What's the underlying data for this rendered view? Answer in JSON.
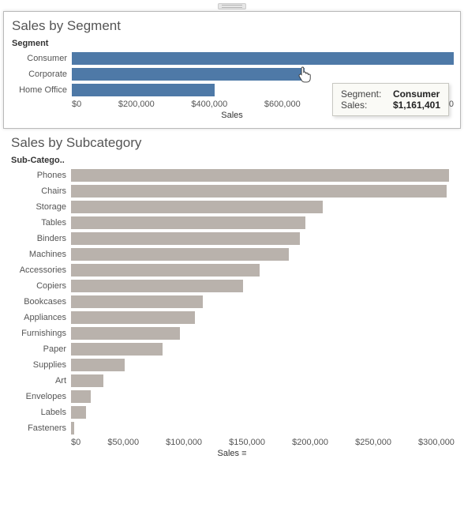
{
  "chart_data": [
    {
      "type": "bar",
      "orientation": "horizontal",
      "title": "Sales by Segment",
      "column_header": "Segment",
      "xlabel": "Sales",
      "xlim": [
        0,
        1150000
      ],
      "ticks": [
        "$0",
        "$200,000",
        "$400,000",
        "$600,000",
        "$800,000",
        "$1,000,000"
      ],
      "categories": [
        "Consumer",
        "Corporate",
        "Home Office"
      ],
      "values": [
        1161401,
        700000,
        430000
      ],
      "bar_color": "#4e79a7",
      "highlighted_index": 0,
      "tooltip": {
        "segment_key": "Segment:",
        "segment_val": "Consumer",
        "sales_key": "Sales:",
        "sales_val": "$1,161,401"
      }
    },
    {
      "type": "bar",
      "orientation": "horizontal",
      "title": "Sales by Subcategory",
      "column_header": "Sub-Catego..",
      "xlabel": "Sales",
      "sort_icon": true,
      "xlim": [
        0,
        335000
      ],
      "ticks": [
        "$0",
        "$50,000",
        "$100,000",
        "$150,000",
        "$200,000",
        "$250,000",
        "$300,000"
      ],
      "categories": [
        "Phones",
        "Chairs",
        "Storage",
        "Tables",
        "Binders",
        "Machines",
        "Accessories",
        "Copiers",
        "Bookcases",
        "Appliances",
        "Furnishings",
        "Paper",
        "Supplies",
        "Art",
        "Envelopes",
        "Labels",
        "Fasteners"
      ],
      "values": [
        330000,
        328000,
        220000,
        205000,
        200000,
        190000,
        165000,
        150000,
        115000,
        108000,
        95000,
        80000,
        47000,
        28000,
        17000,
        13000,
        3000
      ],
      "bar_color": "#b9b2ac"
    }
  ]
}
